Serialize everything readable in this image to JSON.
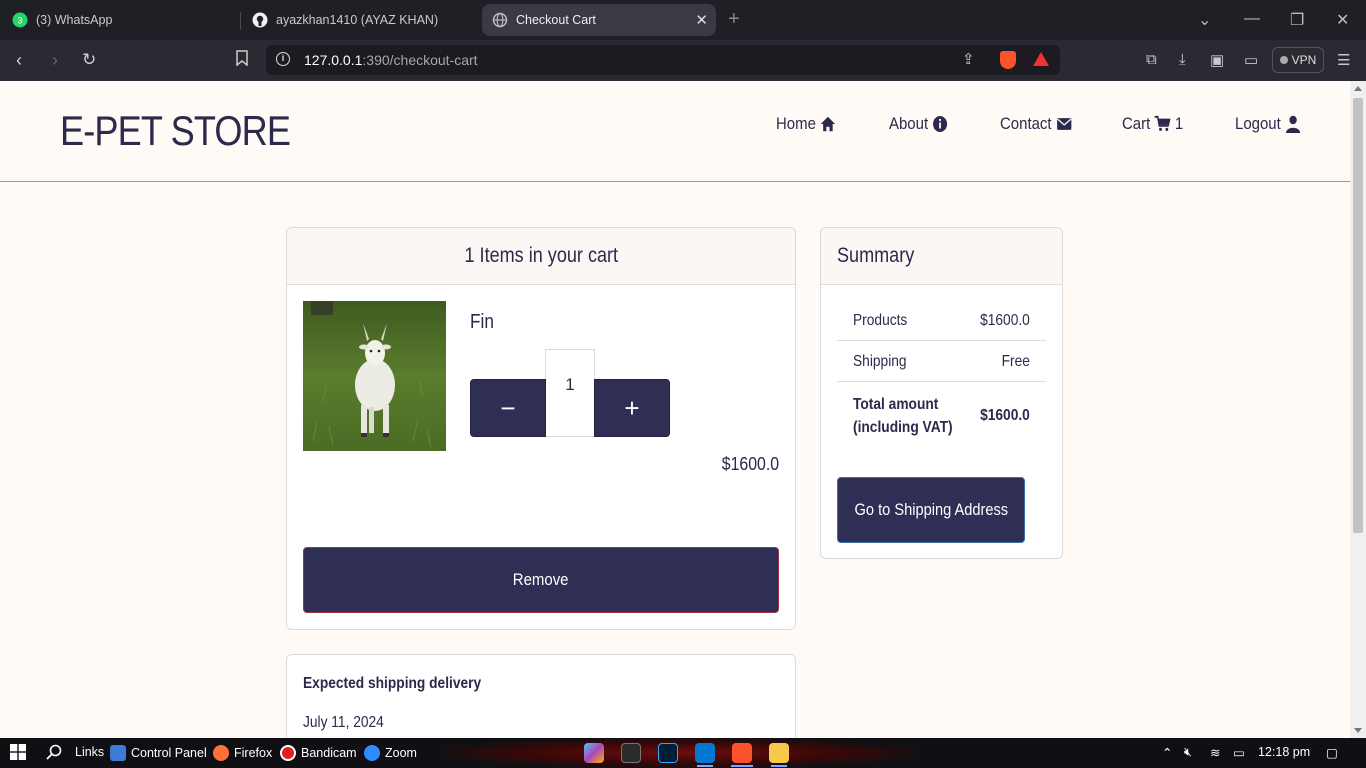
{
  "browser": {
    "tabs": [
      {
        "title": "(3) WhatsApp",
        "badge": "3",
        "icon": "whatsapp-icon",
        "active": false
      },
      {
        "title": "ayazkhan1410 (AYAZ KHAN)",
        "icon": "github-icon",
        "active": false
      },
      {
        "title": "Checkout Cart",
        "icon": "globe-icon",
        "active": true
      }
    ],
    "url_host": "127.0.0.1",
    "url_rest": ":390/checkout-cart",
    "vpn_label": "VPN",
    "new_tab": "+",
    "close_tab": "✕"
  },
  "site": {
    "brand": "E-PET STORE",
    "nav": {
      "home": "Home",
      "about": "About",
      "contact": "Contact",
      "cart": "Cart",
      "cart_count": "1",
      "logout": "Logout"
    }
  },
  "cart": {
    "heading": "1 Items in your cart",
    "item": {
      "name": "Fin",
      "quantity": "1",
      "price": "$1600.0",
      "minus": "−",
      "plus": "+"
    },
    "remove_label": "Remove"
  },
  "summary": {
    "heading": "Summary",
    "products_label": "Products",
    "products_value": "$1600.0",
    "shipping_label": "Shipping",
    "shipping_value": "Free",
    "total_label": "Total amount (including VAT)",
    "total_value": "$1600.0",
    "button_label": "Go to Shipping Address"
  },
  "delivery": {
    "title": "Expected shipping delivery",
    "date": "July 11, 2024"
  },
  "taskbar": {
    "links": "Links",
    "control_panel": "Control Panel",
    "firefox": "Firefox",
    "bandicam": "Bandicam",
    "zoom": "Zoom",
    "time": "12:18 pm"
  },
  "colors": {
    "brand_navy": "#2f2e55",
    "page_bg": "#fffaf6",
    "text": "#2b2a4c"
  }
}
